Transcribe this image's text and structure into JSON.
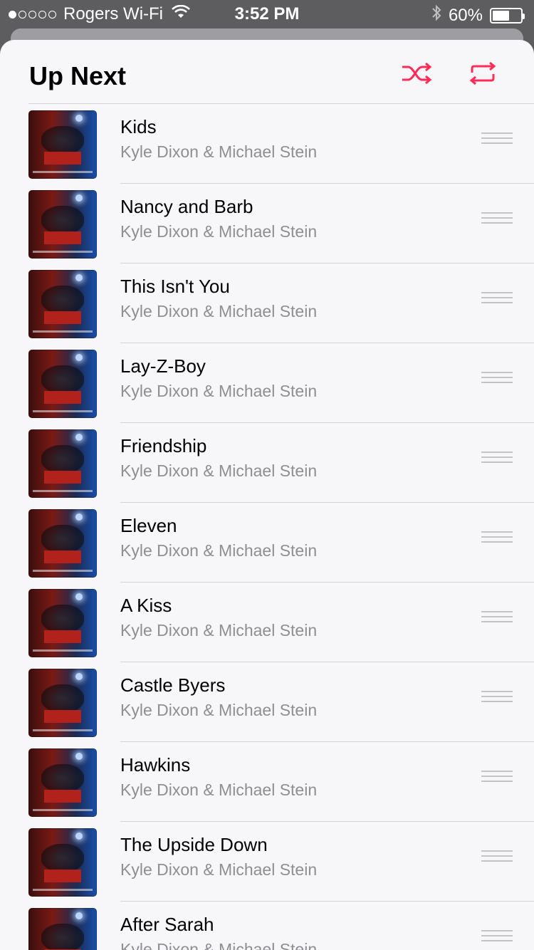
{
  "status_bar": {
    "carrier": "Rogers Wi-Fi",
    "time": "3:52 PM",
    "battery": "60%",
    "battery_level": 0.6
  },
  "header": {
    "title": "Up Next",
    "shuffle_icon": "shuffle-icon",
    "repeat_icon": "repeat-icon",
    "accent_color": "#ff2d55"
  },
  "tracks": [
    {
      "title": "Kids",
      "artist": "Kyle Dixon & Michael Stein"
    },
    {
      "title": "Nancy and Barb",
      "artist": "Kyle Dixon & Michael Stein"
    },
    {
      "title": "This Isn't You",
      "artist": "Kyle Dixon & Michael Stein"
    },
    {
      "title": "Lay-Z-Boy",
      "artist": "Kyle Dixon & Michael Stein"
    },
    {
      "title": "Friendship",
      "artist": "Kyle Dixon & Michael Stein"
    },
    {
      "title": "Eleven",
      "artist": "Kyle Dixon & Michael Stein"
    },
    {
      "title": "A Kiss",
      "artist": "Kyle Dixon & Michael Stein"
    },
    {
      "title": "Castle Byers",
      "artist": "Kyle Dixon & Michael Stein"
    },
    {
      "title": "Hawkins",
      "artist": "Kyle Dixon & Michael Stein"
    },
    {
      "title": "The Upside Down",
      "artist": "Kyle Dixon & Michael Stein"
    },
    {
      "title": "After Sarah",
      "artist": "Kyle Dixon & Michael Stein"
    }
  ]
}
